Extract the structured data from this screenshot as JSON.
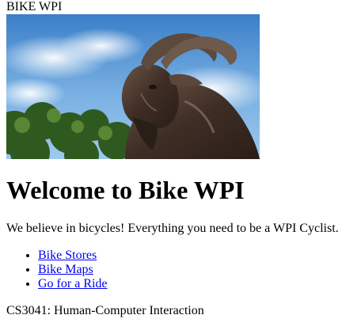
{
  "site": {
    "header_title": "BIKE WPI"
  },
  "hero": {
    "alt": "WPI goat statue"
  },
  "main": {
    "heading": "Welcome to Bike WPI",
    "tagline": "We believe in bicycles! Everything you need to be a WPI Cyclist.",
    "nav_links": [
      {
        "label": "Bike Stores"
      },
      {
        "label": "Bike Maps"
      },
      {
        "label": "Go for a Ride"
      }
    ]
  },
  "footer": {
    "course": "CS3041: Human-Computer Interaction"
  },
  "colors": {
    "link": "#0000ee",
    "text": "#000000",
    "background": "#ffffff"
  }
}
